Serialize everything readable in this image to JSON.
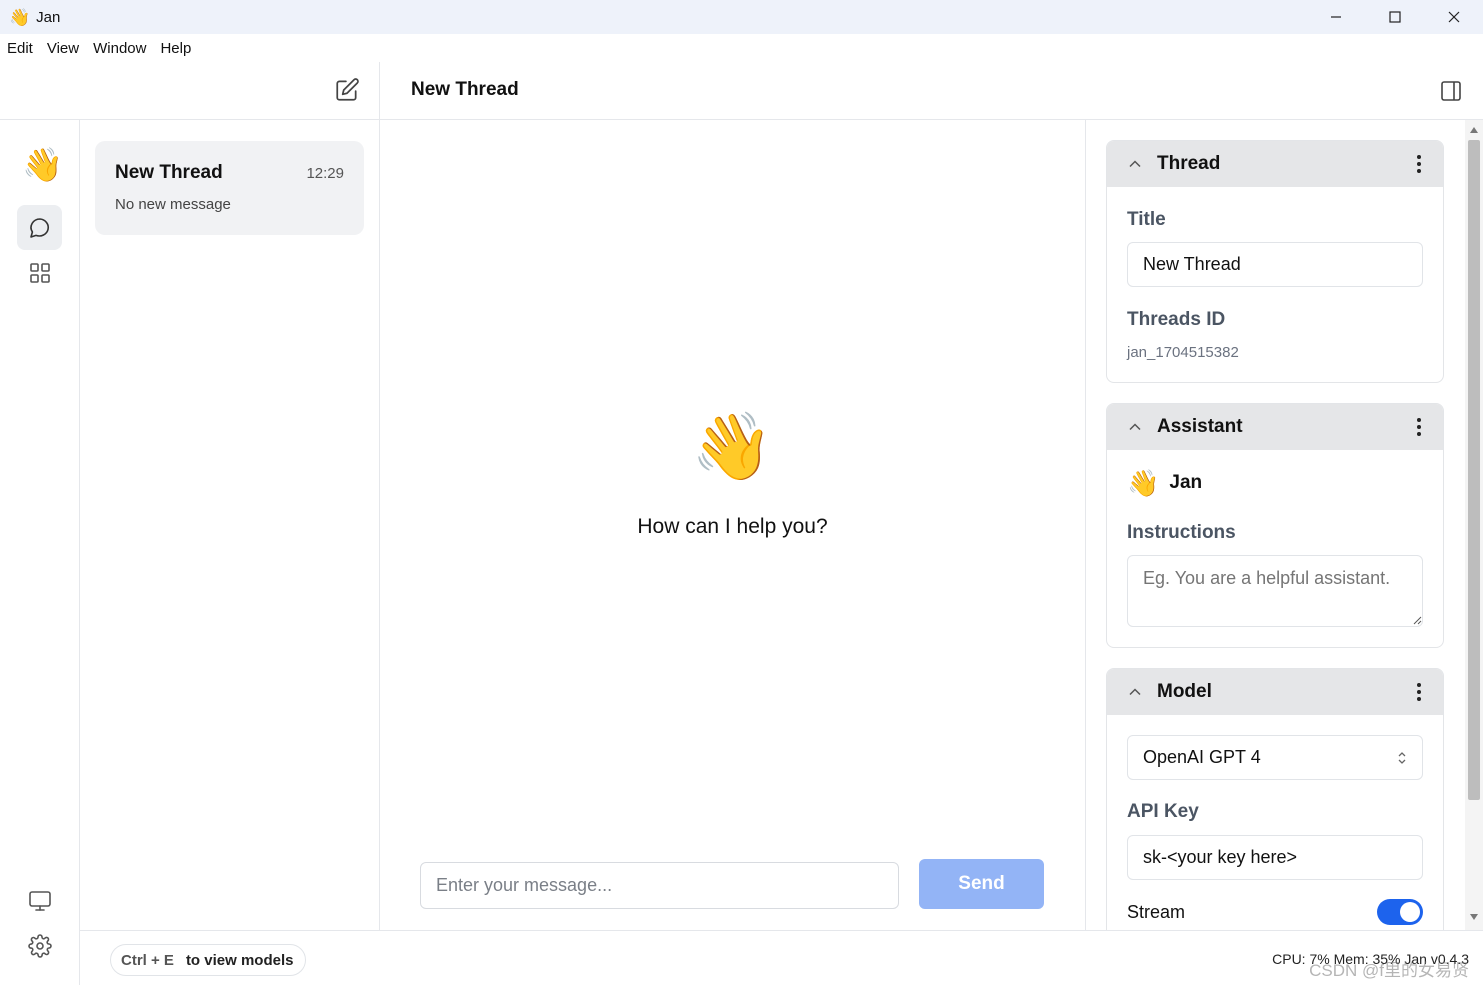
{
  "window": {
    "app_icon": "👋",
    "title": "Jan",
    "controls": [
      "minimize-icon",
      "maximize-icon",
      "close-icon"
    ]
  },
  "menu": {
    "items": [
      "Edit",
      "View",
      "Window",
      "Help"
    ]
  },
  "header": {
    "page_title": "New Thread",
    "compose_icon": "edit-icon",
    "panel_icon": "sidebar-toggle-icon"
  },
  "rail": {
    "logo": "👋",
    "icons": [
      "chat-bubble-icon",
      "grid-icon",
      "monitor-icon",
      "gear-icon"
    ]
  },
  "threads": [
    {
      "title": "New Thread",
      "time": "12:29",
      "subtitle": "No new message"
    }
  ],
  "chat": {
    "welcome_emoji": "👋",
    "welcome_text": "How can I help you?",
    "input_placeholder": "Enter your message...",
    "send_label": "Send"
  },
  "right_panel": {
    "thread": {
      "header": "Thread",
      "title_label": "Title",
      "title_value": "New Thread",
      "id_label": "Threads ID",
      "id_value": "jan_1704515382"
    },
    "assistant": {
      "header": "Assistant",
      "avatar": "👋",
      "name": "Jan",
      "instructions_label": "Instructions",
      "instructions_placeholder": "Eg. You are a helpful assistant."
    },
    "model": {
      "header": "Model",
      "selected_model": "OpenAI GPT 4",
      "api_key_label": "API Key",
      "api_key_value": "sk-<your key here>",
      "stream_label": "Stream",
      "stream_enabled": true
    }
  },
  "status": {
    "shortcut_keys": "Ctrl + E",
    "shortcut_text": "to view models",
    "stats": "CPU: 7%   Mem: 35%   Jan v0.4.3",
    "watermark": "CSDN @f里的女易贤"
  },
  "colors": {
    "accent": "#1d63ed",
    "send_button": "#93b4f6",
    "card_header": "#e5e6e8",
    "titlebar": "#eef2fa"
  }
}
